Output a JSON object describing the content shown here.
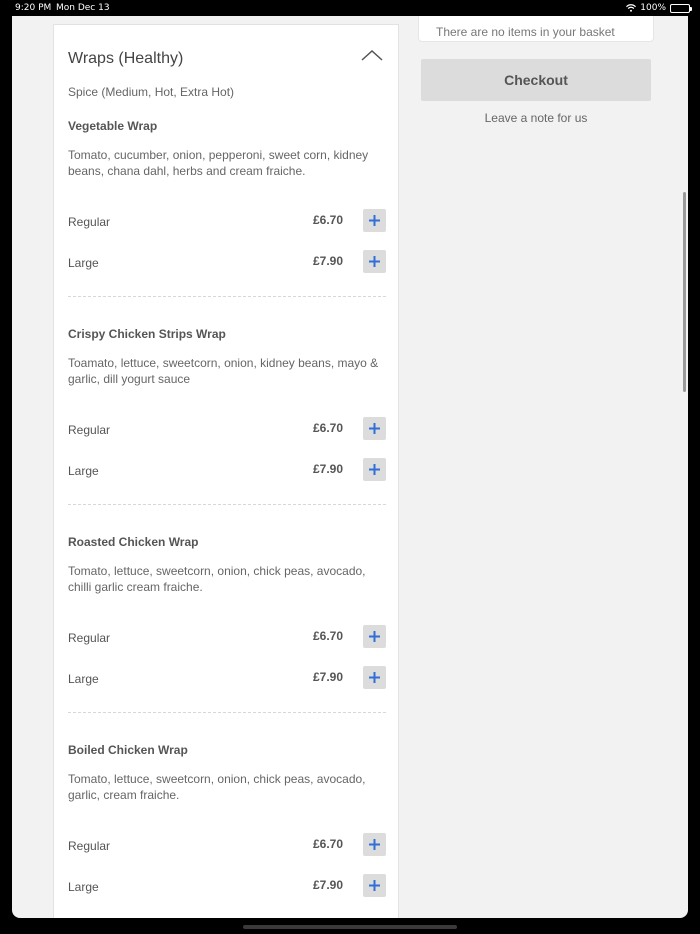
{
  "status_bar": {
    "time": "9:20 PM",
    "date": "Mon Dec 13",
    "battery": "100%"
  },
  "basket": {
    "empty_message": "There are no items in your basket",
    "checkout_label": "Checkout",
    "note_link": "Leave a note for us"
  },
  "section": {
    "title": "Wraps (Healthy)",
    "subtitle": "Spice (Medium, Hot, Extra Hot)",
    "items": [
      {
        "name": "Vegetable Wrap",
        "description": "Tomato, cucumber, onion, pepperoni, sweet corn, kidney beans, chana dahl, herbs and cream fraiche.",
        "sizes": [
          {
            "label": "Regular",
            "price": "£6.70"
          },
          {
            "label": "Large",
            "price": "£7.90"
          }
        ]
      },
      {
        "name": "Crispy Chicken Strips Wrap",
        "description": "Toamato, lettuce, sweetcorn, onion, kidney beans, mayo & garlic, dill yogurt sauce",
        "sizes": [
          {
            "label": "Regular",
            "price": "£6.70"
          },
          {
            "label": "Large",
            "price": "£7.90"
          }
        ]
      },
      {
        "name": "Roasted Chicken Wrap",
        "description": "Tomato, lettuce, sweetcorn, onion, chick peas, avocado, chilli garlic cream fraiche.",
        "sizes": [
          {
            "label": "Regular",
            "price": "£6.70"
          },
          {
            "label": "Large",
            "price": "£7.90"
          }
        ]
      },
      {
        "name": "Boiled Chicken Wrap",
        "description": "Tomato, lettuce, sweetcorn, onion, chick peas, avocado, garlic, cream fraiche.",
        "sizes": [
          {
            "label": "Regular",
            "price": "£6.70"
          },
          {
            "label": "Large",
            "price": "£7.90"
          }
        ]
      }
    ]
  },
  "icons": {
    "collapse": "chevron-up-icon",
    "add": "plus-icon",
    "wifi": "wifi-icon",
    "battery": "battery-icon"
  },
  "colors": {
    "accent": "#2f6fd6",
    "button_bg": "#dcdcdc",
    "page_bg": "#f2f2f2"
  }
}
